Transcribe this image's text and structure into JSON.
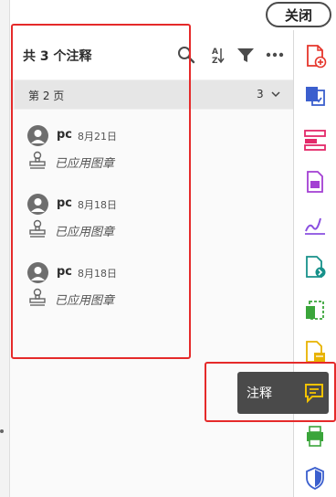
{
  "topbar": {
    "close_label": "关闭"
  },
  "panel": {
    "title": "共 3 个注释",
    "page_label": "第 2 页",
    "page_count": "3"
  },
  "comments": [
    {
      "author": "pc",
      "date": "8月21日",
      "text": "已应用图章"
    },
    {
      "author": "pc",
      "date": "8月18日",
      "text": "已应用图章"
    },
    {
      "author": "pc",
      "date": "8月18日",
      "text": "已应用图章"
    }
  ],
  "header_icons": [
    "search-icon",
    "sort-az-icon",
    "filter-icon",
    "more-icon"
  ],
  "tools": [
    {
      "icon": "create-pdf-icon",
      "color": "#e5352b"
    },
    {
      "icon": "combine-files-icon",
      "color": "#3b5fce"
    },
    {
      "icon": "organize-pages-icon",
      "color": "#e3296a"
    },
    {
      "icon": "edit-pdf-icon",
      "color": "#a33fd3"
    },
    {
      "icon": "fill-sign-icon",
      "color": "#8a4fe0"
    },
    {
      "icon": "export-pdf-icon",
      "color": "#17918a"
    },
    {
      "icon": "scan-ocr-icon",
      "color": "#3aa53a"
    },
    {
      "icon": "comment-icon",
      "color": "#e8b300"
    },
    {
      "icon": "print-production-icon",
      "color": "#3aa53a"
    },
    {
      "icon": "protect-icon",
      "color": "#3b5fce"
    }
  ],
  "tooltip": {
    "label": "注释",
    "icon": "comment-icon",
    "color": "#f2c200"
  },
  "colors": {
    "highlight_box": "#e52a2a",
    "panel_bg": "#f0f0f0"
  }
}
